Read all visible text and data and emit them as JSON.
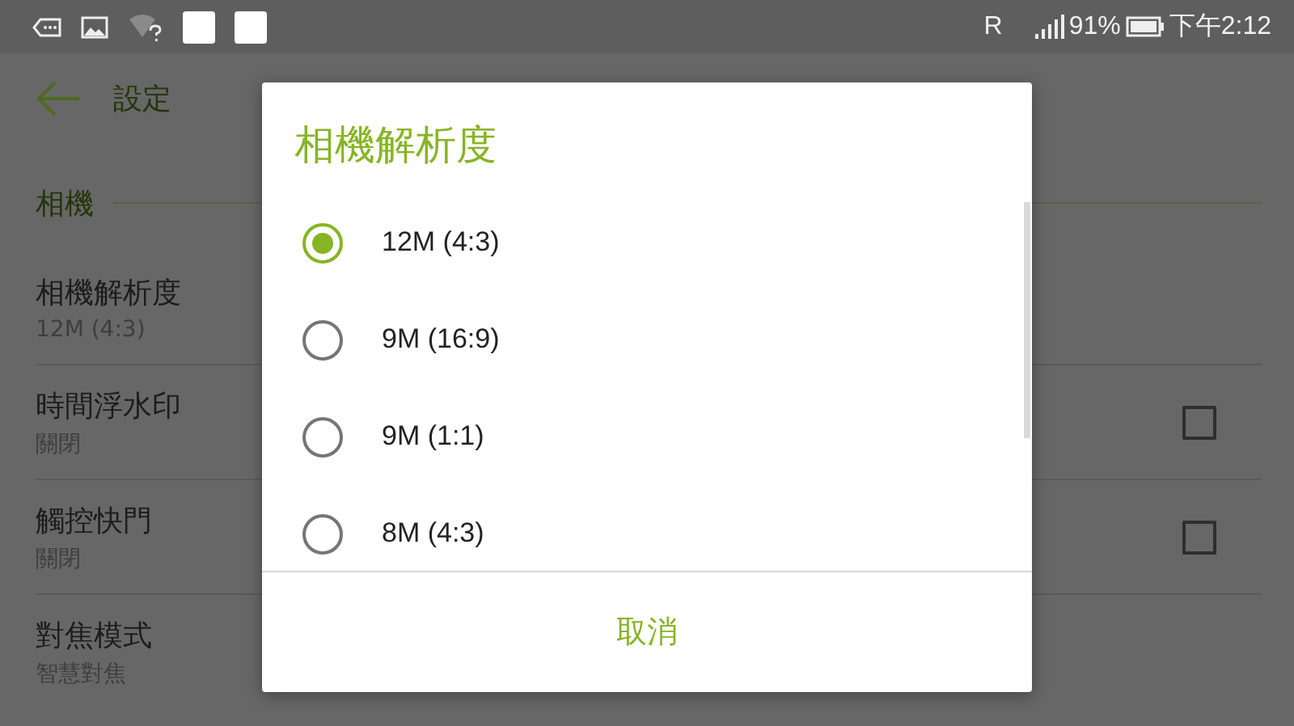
{
  "status_bar": {
    "roaming": "R",
    "battery": "91%",
    "time": "下午2:12"
  },
  "header": {
    "title": "設定"
  },
  "section": {
    "title": "相機"
  },
  "settings": [
    {
      "kind": "plain",
      "title": "相機解析度",
      "summary": "12M (4:3)"
    },
    {
      "kind": "checkbox",
      "title": "時間浮水印",
      "summary": "關閉",
      "checked": false
    },
    {
      "kind": "checkbox",
      "title": "觸控快門",
      "summary": "關閉",
      "checked": false
    },
    {
      "kind": "plain",
      "title": "對焦模式",
      "summary": "智慧對焦"
    }
  ],
  "dialog": {
    "title": "相機解析度",
    "options": [
      {
        "label": "12M (4:3)",
        "selected": true
      },
      {
        "label": "9M (16:9)",
        "selected": false
      },
      {
        "label": "9M (1:1)",
        "selected": false
      },
      {
        "label": "8M (4:3)",
        "selected": false
      }
    ],
    "buttons": [
      "取消"
    ]
  }
}
